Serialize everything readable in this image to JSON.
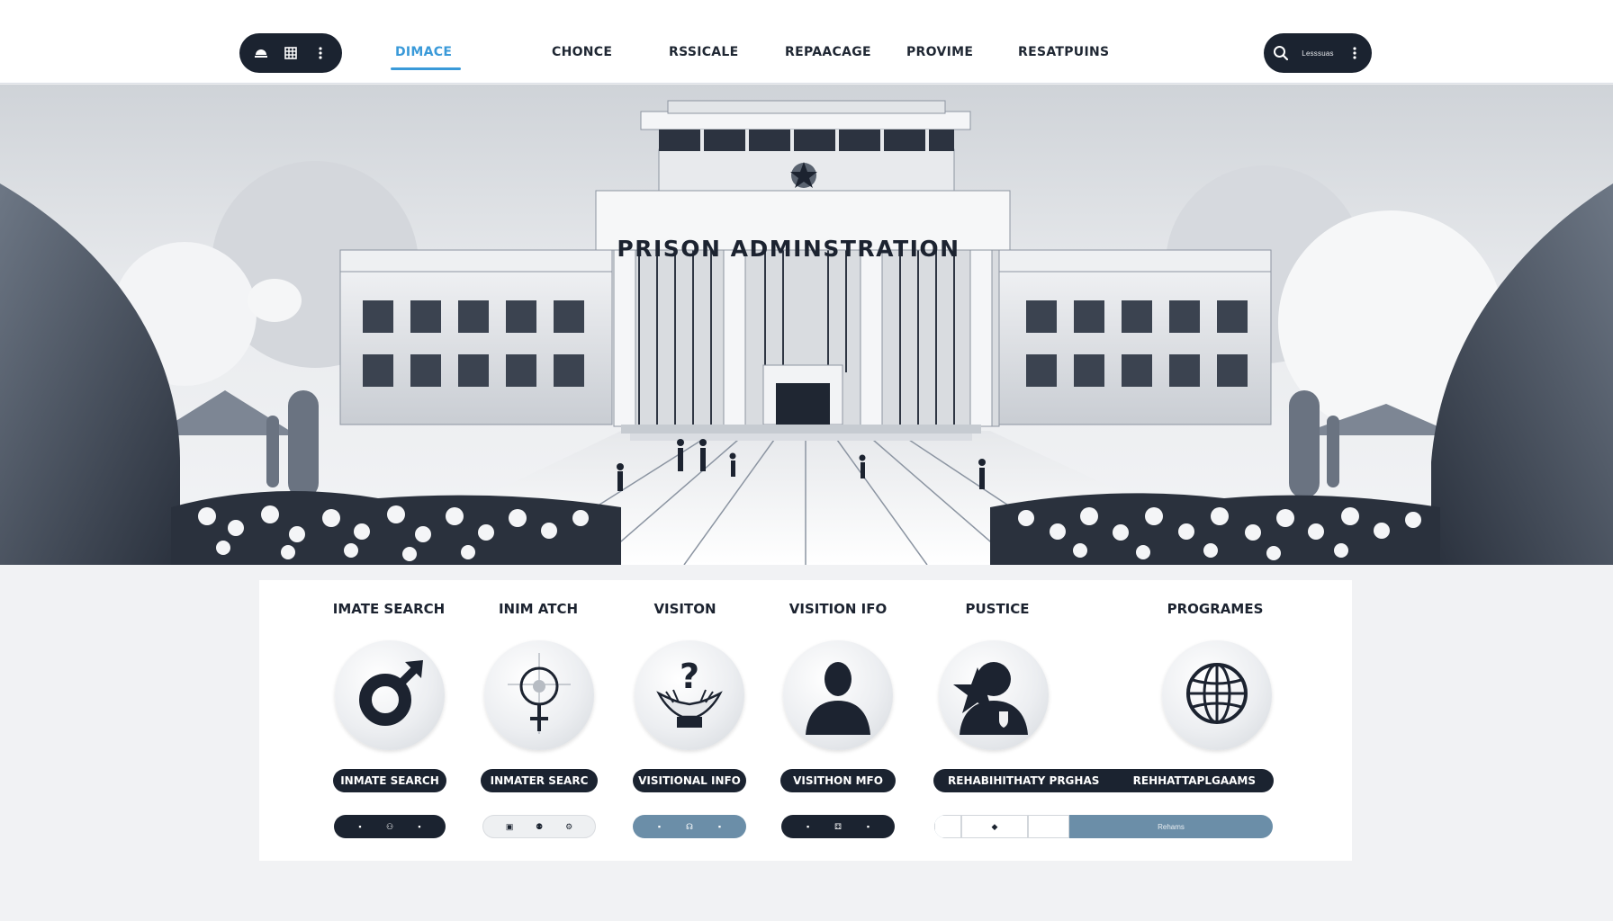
{
  "nav": {
    "left_icons": [
      "dome-icon",
      "grid-icon",
      "more-vertical-icon"
    ],
    "tabs": [
      {
        "label": "DIMACE",
        "active": true
      },
      {
        "label": "CHONCE",
        "active": false
      },
      {
        "label": "RSSICALE",
        "active": false
      },
      {
        "label": "REPAACAGE",
        "active": false
      },
      {
        "label": "PROVIME",
        "active": false
      },
      {
        "label": "RESATPUINS",
        "active": false
      }
    ],
    "search": {
      "icon": "search-icon",
      "text": "Lesssuas",
      "more_icon": "more-vertical-icon"
    },
    "accent_color": "#3a9ad9"
  },
  "hero": {
    "building_title": "PRISON ADMINSTRATION",
    "emblem": "star-icon"
  },
  "columns": [
    {
      "title": "IMATE SEARCH",
      "icon": "male-symbol-icon",
      "button": "INMATE SEARCH",
      "controls": [
        "▪",
        "⚇",
        "▪"
      ],
      "control_style": "dark"
    },
    {
      "title": "INIM ATCH",
      "icon": "female-symbol-icon",
      "button": "INMATER SEARC",
      "controls": [
        "▣",
        "⚉",
        "⚙"
      ],
      "control_style": "light"
    },
    {
      "title": "VISITON",
      "icon": "helping-hands-question-icon",
      "button": "VISITIONAL INFO",
      "controls": [
        "▪",
        "☊",
        "▪"
      ],
      "control_style": "blue"
    },
    {
      "title": "VISITION IFO",
      "icon": "person-silhouette-icon",
      "button": "VISITHON MFO",
      "controls": [
        "▪",
        "⚃",
        "▪"
      ],
      "control_style": "dark"
    },
    {
      "title": "PUSTICE",
      "icon": "officer-badge-icon"
    },
    {
      "title": "PROGRAMES",
      "icon": "globe-icon"
    }
  ],
  "rehab": {
    "button_left": "REHABIHITHATY PRGHAS",
    "button_right": "REHHATTAPLGAAMS",
    "controls": [
      "",
      "◆",
      ""
    ],
    "bar_label": "Rehams"
  },
  "separator_icon": "star-icon"
}
